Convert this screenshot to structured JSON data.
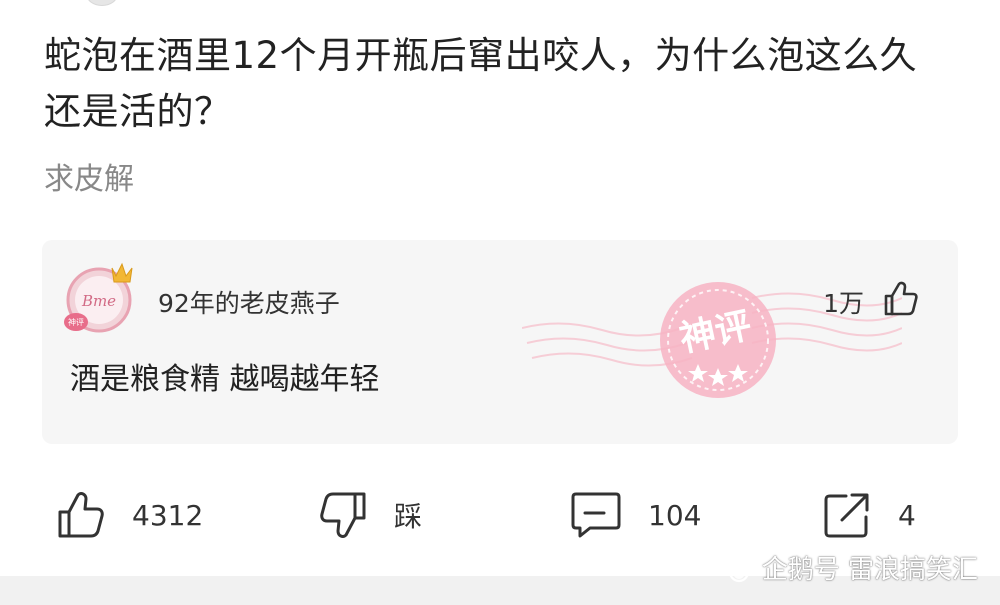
{
  "post": {
    "title": "蛇泡在酒里12个月开瓶后窜出咬人，为什么泡这么久还是活的？",
    "body": "求皮解"
  },
  "hot_comment": {
    "username": "92年的老皮燕子",
    "like_count": "1万",
    "text": "酒是粮食精 越喝越年轻",
    "badge": "神评",
    "avatar_badge": "神评",
    "avatar_icon": "avatar-with-crown-icon"
  },
  "actions": {
    "like_count": "4312",
    "dislike_label": "踩",
    "comment_count": "104",
    "share_count": "4"
  },
  "watermark": {
    "text": "企鹅号 雷浪搞笑汇"
  },
  "colors": {
    "stamp_pink": "#f6b8c6",
    "card_bg": "#f6f6f6",
    "title_text": "#222222",
    "muted_text": "#888888"
  }
}
